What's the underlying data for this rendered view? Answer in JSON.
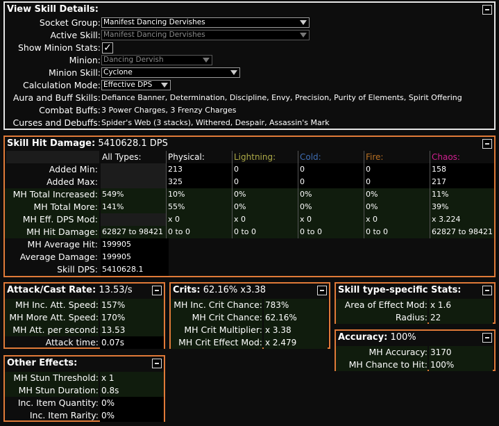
{
  "skill_details": {
    "title": "View Skill Details:",
    "socket_group_label": "Socket Group:",
    "socket_group_value": "Manifest Dancing Dervishes",
    "active_skill_label": "Active Skill:",
    "active_skill_value": "Manifest Dancing Dervishes",
    "show_minion_label": "Show Minion Stats:",
    "show_minion_checked": "✓",
    "minion_label": "Minion:",
    "minion_value": "Dancing Dervish",
    "minion_skill_label": "Minion Skill:",
    "minion_skill_value": "Cyclone",
    "calc_mode_label": "Calculation Mode:",
    "calc_mode_value": "Effective DPS",
    "aura_label": "Aura and Buff Skills:",
    "aura_value": "Defiance Banner, Determination, Discipline, Envy, Precision, Purity of Elements, Spirit Offering",
    "combat_label": "Combat Buffs:",
    "combat_value": "3 Power Charges, 3 Frenzy Charges",
    "curses_label": "Curses and Debuffs:",
    "curses_value": "Spider's Web (3 stacks), Withered, Despair, Assassin's Mark"
  },
  "hit_damage": {
    "title": "Skill Hit Damage:",
    "title_value": "5410628.1 DPS",
    "col_headers": [
      "All Types:",
      "Physical:",
      "Lightning:",
      "Cold:",
      "Fire:",
      "Chaos:"
    ],
    "col_colors": [
      "#ffffff",
      "#ffffff",
      "#adaa47",
      "#3f6db3",
      "#b97123",
      "#d02090"
    ],
    "rows": [
      {
        "label": "Added Min:",
        "cells": [
          "",
          "213",
          "0",
          "0",
          "0",
          "158"
        ]
      },
      {
        "label": "Added Max:",
        "cells": [
          "",
          "325",
          "0",
          "0",
          "0",
          "217"
        ]
      },
      {
        "label": "MH Total Increased:",
        "cells": [
          "549%",
          "10%",
          "0%",
          "0%",
          "0%",
          "11%"
        ]
      },
      {
        "label": "MH Total More:",
        "cells": [
          "141%",
          "55%",
          "0%",
          "0%",
          "0%",
          "39%"
        ]
      },
      {
        "label": "MH Eff. DPS Mod:",
        "cells": [
          "",
          "x 0",
          "x 0",
          "x 0",
          "x 0",
          "x 3.224"
        ]
      },
      {
        "label": "MH Hit Damage:",
        "cells": [
          "62827 to 98421",
          "0 to 0",
          "0 to 0",
          "0 to 0",
          "0 to 0",
          "62827 to 98421"
        ]
      },
      {
        "label": "MH Average Hit:",
        "cells": [
          "199905"
        ]
      },
      {
        "label": "Average Damage:",
        "cells": [
          "199905"
        ]
      },
      {
        "label": "Skill DPS:",
        "cells": [
          "5410628.1"
        ]
      }
    ]
  },
  "attack_rate": {
    "title": "Attack/Cast Rate:",
    "title_value": "13.53/s",
    "rows": [
      {
        "label": "MH Inc. Att. Speed:",
        "value": "157%"
      },
      {
        "label": "MH More Att. Speed:",
        "value": "170%"
      },
      {
        "label": "MH Att. per second:",
        "value": "13.53"
      },
      {
        "label": "Attack time:",
        "value": "0.07s"
      }
    ]
  },
  "crits": {
    "title": "Crits:",
    "title_value": "62.16% x3.38",
    "rows": [
      {
        "label": "MH Inc. Crit Chance:",
        "value": "783%"
      },
      {
        "label": "MH Crit Chance:",
        "value": "62.16%"
      },
      {
        "label": "MH Crit Multiplier:",
        "value": "x 3.38"
      },
      {
        "label": "MH Crit Effect Mod:",
        "value": "x 2.479"
      }
    ]
  },
  "skill_type": {
    "title": "Skill type-specific Stats:",
    "rows": [
      {
        "label": "Area of Effect Mod:",
        "value": "x 1.6"
      },
      {
        "label": "Radius:",
        "value": "22"
      }
    ]
  },
  "accuracy": {
    "title": "Accuracy:",
    "title_value": "100%",
    "rows": [
      {
        "label": "MH Accuracy:",
        "value": "3170"
      },
      {
        "label": "MH Chance to Hit:",
        "value": "100%"
      }
    ]
  },
  "other_effects": {
    "title": "Other Effects:",
    "rows": [
      {
        "label": "MH Stun Threshold:",
        "value": "x 1"
      },
      {
        "label": "MH Stun Duration:",
        "value": "0.8s"
      },
      {
        "label": "Inc. Item Quantity:",
        "value": "0%"
      },
      {
        "label": "Inc. Item Rarity:",
        "value": "0%"
      }
    ]
  }
}
